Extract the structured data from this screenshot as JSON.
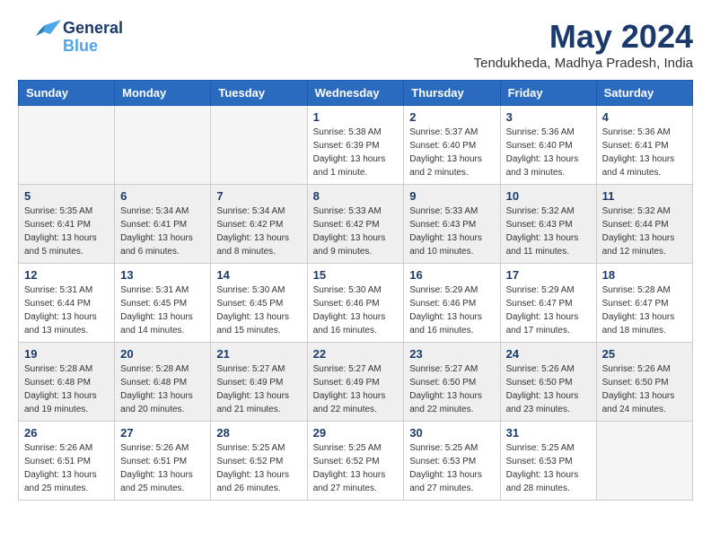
{
  "logo": {
    "general": "General",
    "blue": "Blue"
  },
  "title": "May 2024",
  "location": "Tendukheda, Madhya Pradesh, India",
  "weekdays": [
    "Sunday",
    "Monday",
    "Tuesday",
    "Wednesday",
    "Thursday",
    "Friday",
    "Saturday"
  ],
  "weeks": [
    [
      {
        "day": "",
        "sunrise": "",
        "sunset": "",
        "daylight": "",
        "empty": true
      },
      {
        "day": "",
        "sunrise": "",
        "sunset": "",
        "daylight": "",
        "empty": true
      },
      {
        "day": "",
        "sunrise": "",
        "sunset": "",
        "daylight": "",
        "empty": true
      },
      {
        "day": "1",
        "sunrise": "Sunrise: 5:38 AM",
        "sunset": "Sunset: 6:39 PM",
        "daylight": "Daylight: 13 hours and 1 minute."
      },
      {
        "day": "2",
        "sunrise": "Sunrise: 5:37 AM",
        "sunset": "Sunset: 6:40 PM",
        "daylight": "Daylight: 13 hours and 2 minutes."
      },
      {
        "day": "3",
        "sunrise": "Sunrise: 5:36 AM",
        "sunset": "Sunset: 6:40 PM",
        "daylight": "Daylight: 13 hours and 3 minutes."
      },
      {
        "day": "4",
        "sunrise": "Sunrise: 5:36 AM",
        "sunset": "Sunset: 6:41 PM",
        "daylight": "Daylight: 13 hours and 4 minutes."
      }
    ],
    [
      {
        "day": "5",
        "sunrise": "Sunrise: 5:35 AM",
        "sunset": "Sunset: 6:41 PM",
        "daylight": "Daylight: 13 hours and 5 minutes."
      },
      {
        "day": "6",
        "sunrise": "Sunrise: 5:34 AM",
        "sunset": "Sunset: 6:41 PM",
        "daylight": "Daylight: 13 hours and 6 minutes."
      },
      {
        "day": "7",
        "sunrise": "Sunrise: 5:34 AM",
        "sunset": "Sunset: 6:42 PM",
        "daylight": "Daylight: 13 hours and 8 minutes."
      },
      {
        "day": "8",
        "sunrise": "Sunrise: 5:33 AM",
        "sunset": "Sunset: 6:42 PM",
        "daylight": "Daylight: 13 hours and 9 minutes."
      },
      {
        "day": "9",
        "sunrise": "Sunrise: 5:33 AM",
        "sunset": "Sunset: 6:43 PM",
        "daylight": "Daylight: 13 hours and 10 minutes."
      },
      {
        "day": "10",
        "sunrise": "Sunrise: 5:32 AM",
        "sunset": "Sunset: 6:43 PM",
        "daylight": "Daylight: 13 hours and 11 minutes."
      },
      {
        "day": "11",
        "sunrise": "Sunrise: 5:32 AM",
        "sunset": "Sunset: 6:44 PM",
        "daylight": "Daylight: 13 hours and 12 minutes."
      }
    ],
    [
      {
        "day": "12",
        "sunrise": "Sunrise: 5:31 AM",
        "sunset": "Sunset: 6:44 PM",
        "daylight": "Daylight: 13 hours and 13 minutes."
      },
      {
        "day": "13",
        "sunrise": "Sunrise: 5:31 AM",
        "sunset": "Sunset: 6:45 PM",
        "daylight": "Daylight: 13 hours and 14 minutes."
      },
      {
        "day": "14",
        "sunrise": "Sunrise: 5:30 AM",
        "sunset": "Sunset: 6:45 PM",
        "daylight": "Daylight: 13 hours and 15 minutes."
      },
      {
        "day": "15",
        "sunrise": "Sunrise: 5:30 AM",
        "sunset": "Sunset: 6:46 PM",
        "daylight": "Daylight: 13 hours and 16 minutes."
      },
      {
        "day": "16",
        "sunrise": "Sunrise: 5:29 AM",
        "sunset": "Sunset: 6:46 PM",
        "daylight": "Daylight: 13 hours and 16 minutes."
      },
      {
        "day": "17",
        "sunrise": "Sunrise: 5:29 AM",
        "sunset": "Sunset: 6:47 PM",
        "daylight": "Daylight: 13 hours and 17 minutes."
      },
      {
        "day": "18",
        "sunrise": "Sunrise: 5:28 AM",
        "sunset": "Sunset: 6:47 PM",
        "daylight": "Daylight: 13 hours and 18 minutes."
      }
    ],
    [
      {
        "day": "19",
        "sunrise": "Sunrise: 5:28 AM",
        "sunset": "Sunset: 6:48 PM",
        "daylight": "Daylight: 13 hours and 19 minutes."
      },
      {
        "day": "20",
        "sunrise": "Sunrise: 5:28 AM",
        "sunset": "Sunset: 6:48 PM",
        "daylight": "Daylight: 13 hours and 20 minutes."
      },
      {
        "day": "21",
        "sunrise": "Sunrise: 5:27 AM",
        "sunset": "Sunset: 6:49 PM",
        "daylight": "Daylight: 13 hours and 21 minutes."
      },
      {
        "day": "22",
        "sunrise": "Sunrise: 5:27 AM",
        "sunset": "Sunset: 6:49 PM",
        "daylight": "Daylight: 13 hours and 22 minutes."
      },
      {
        "day": "23",
        "sunrise": "Sunrise: 5:27 AM",
        "sunset": "Sunset: 6:50 PM",
        "daylight": "Daylight: 13 hours and 22 minutes."
      },
      {
        "day": "24",
        "sunrise": "Sunrise: 5:26 AM",
        "sunset": "Sunset: 6:50 PM",
        "daylight": "Daylight: 13 hours and 23 minutes."
      },
      {
        "day": "25",
        "sunrise": "Sunrise: 5:26 AM",
        "sunset": "Sunset: 6:50 PM",
        "daylight": "Daylight: 13 hours and 24 minutes."
      }
    ],
    [
      {
        "day": "26",
        "sunrise": "Sunrise: 5:26 AM",
        "sunset": "Sunset: 6:51 PM",
        "daylight": "Daylight: 13 hours and 25 minutes."
      },
      {
        "day": "27",
        "sunrise": "Sunrise: 5:26 AM",
        "sunset": "Sunset: 6:51 PM",
        "daylight": "Daylight: 13 hours and 25 minutes."
      },
      {
        "day": "28",
        "sunrise": "Sunrise: 5:25 AM",
        "sunset": "Sunset: 6:52 PM",
        "daylight": "Daylight: 13 hours and 26 minutes."
      },
      {
        "day": "29",
        "sunrise": "Sunrise: 5:25 AM",
        "sunset": "Sunset: 6:52 PM",
        "daylight": "Daylight: 13 hours and 27 minutes."
      },
      {
        "day": "30",
        "sunrise": "Sunrise: 5:25 AM",
        "sunset": "Sunset: 6:53 PM",
        "daylight": "Daylight: 13 hours and 27 minutes."
      },
      {
        "day": "31",
        "sunrise": "Sunrise: 5:25 AM",
        "sunset": "Sunset: 6:53 PM",
        "daylight": "Daylight: 13 hours and 28 minutes."
      },
      {
        "day": "",
        "sunrise": "",
        "sunset": "",
        "daylight": "",
        "empty": true
      }
    ]
  ]
}
